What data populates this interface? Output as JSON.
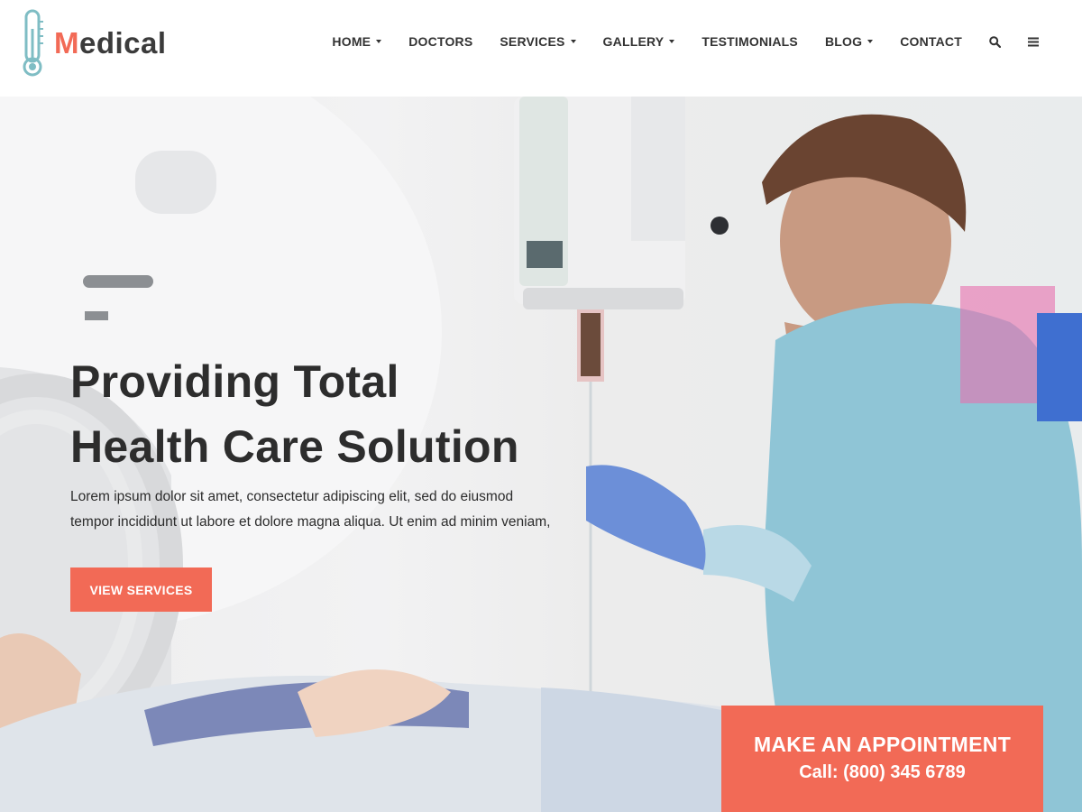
{
  "brand": {
    "name_first": "M",
    "name_rest": "edical",
    "accent_color": "#f26a56",
    "icon": "thermometer-icon"
  },
  "nav": {
    "items": [
      {
        "label": "HOME",
        "dropdown": true
      },
      {
        "label": "DOCTORS",
        "dropdown": false
      },
      {
        "label": "SERVICES",
        "dropdown": true
      },
      {
        "label": "GALLERY",
        "dropdown": true
      },
      {
        "label": "TESTIMONIALS",
        "dropdown": false
      },
      {
        "label": "BLOG",
        "dropdown": true
      },
      {
        "label": "CONTACT",
        "dropdown": false
      }
    ],
    "icons": [
      "search-icon",
      "menu-icon"
    ]
  },
  "hero": {
    "title_line1": "Providing Total",
    "title_line2": "Health Care Solution",
    "text_line1": "Lorem ipsum dolor sit amet, consectetur adipiscing elit, sed do eiusmod",
    "text_line2": "tempor incididunt ut labore et dolore magna aliqua. Ut enim ad minim veniam,",
    "button_label": "VIEW SERVICES"
  },
  "appointment": {
    "title": "MAKE AN APPOINTMENT",
    "call": "Call: (800) 345 6789"
  }
}
